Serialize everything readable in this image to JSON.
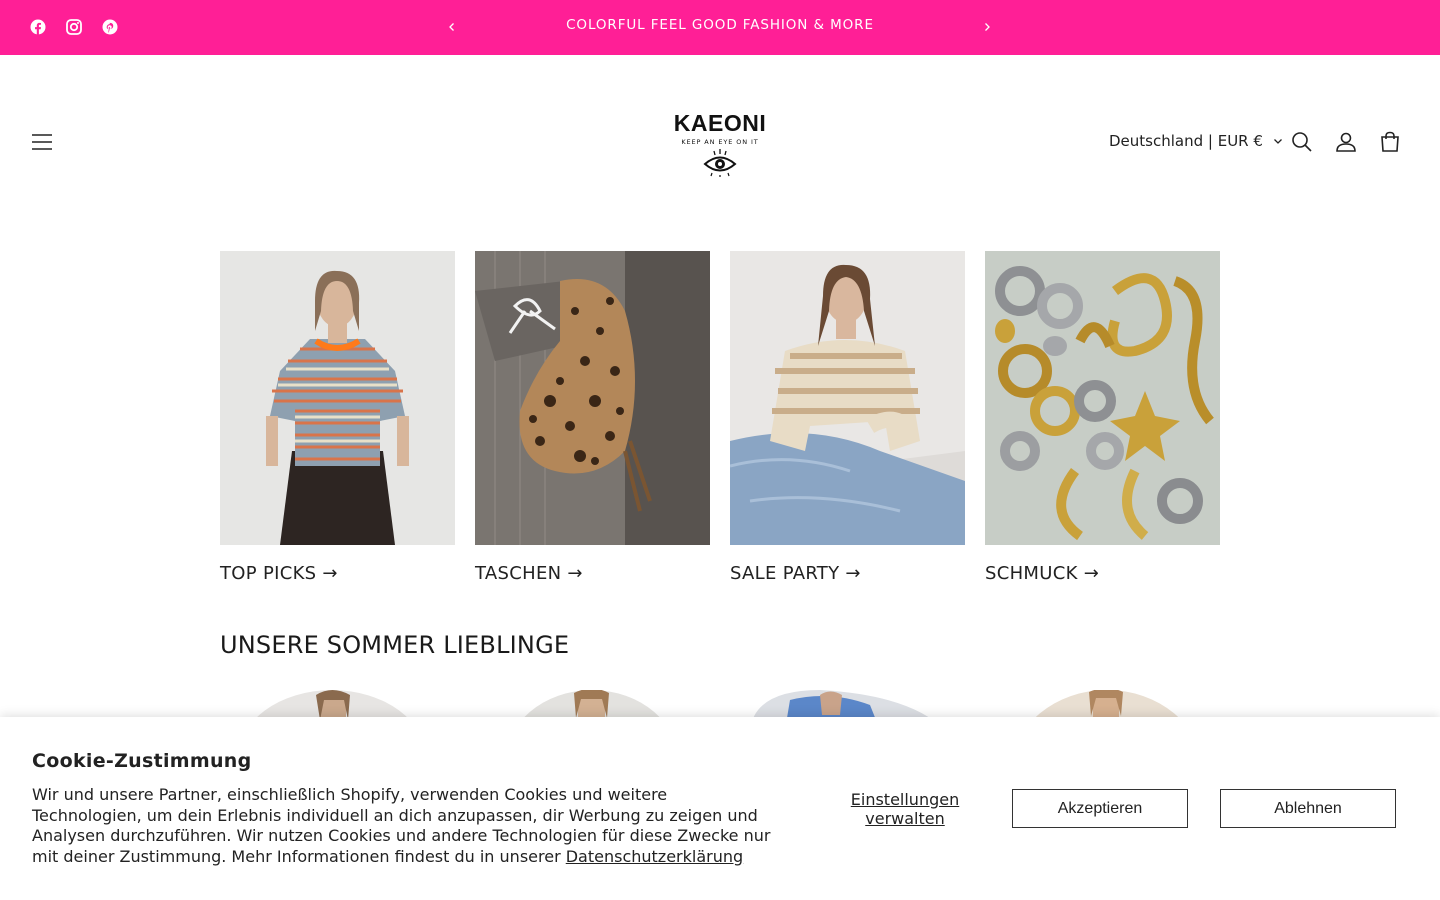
{
  "announcement": {
    "text": "COLORFUL FEEL GOOD FASHION & MORE",
    "bg_color": "#ff1f96",
    "social_icons": [
      "facebook-icon",
      "instagram-icon",
      "pinterest-icon"
    ],
    "prev_icon": "chevron-left-icon",
    "next_icon": "chevron-right-icon"
  },
  "header": {
    "logo_text": "KAEONI",
    "logo_tagline": "KEEP AN EYE ON IT",
    "country_selector": "Deutschland | EUR €",
    "icons": [
      "menu-icon",
      "search-icon",
      "account-icon",
      "cart-icon"
    ]
  },
  "categories": [
    {
      "label": "TOP PICKS",
      "arrow": "→"
    },
    {
      "label": "TASCHEN",
      "arrow": "→"
    },
    {
      "label": "SALE PARTY",
      "arrow": "→"
    },
    {
      "label": "SCHMUCK",
      "arrow": "→"
    }
  ],
  "section": {
    "title": "UNSERE SOMMER LIEBLINGE"
  },
  "cookie": {
    "title": "Cookie-Zustimmung",
    "text": "Wir und unsere Partner, einschließlich Shopify, verwenden Cookies und weitere Technologien, um dein Erlebnis individuell an dich anzupassen, dir Werbung zu zeigen und Analysen durchzuführen. Wir nutzen Cookies und andere Technologien für diese Zwecke nur mit deiner Zustimmung. Mehr Informationen findest du in unserer ",
    "privacy_link": "Datenschutzerklärung",
    "manage_label": "Einstellungen verwalten",
    "accept_label": "Akzeptieren",
    "decline_label": "Ablehnen"
  }
}
